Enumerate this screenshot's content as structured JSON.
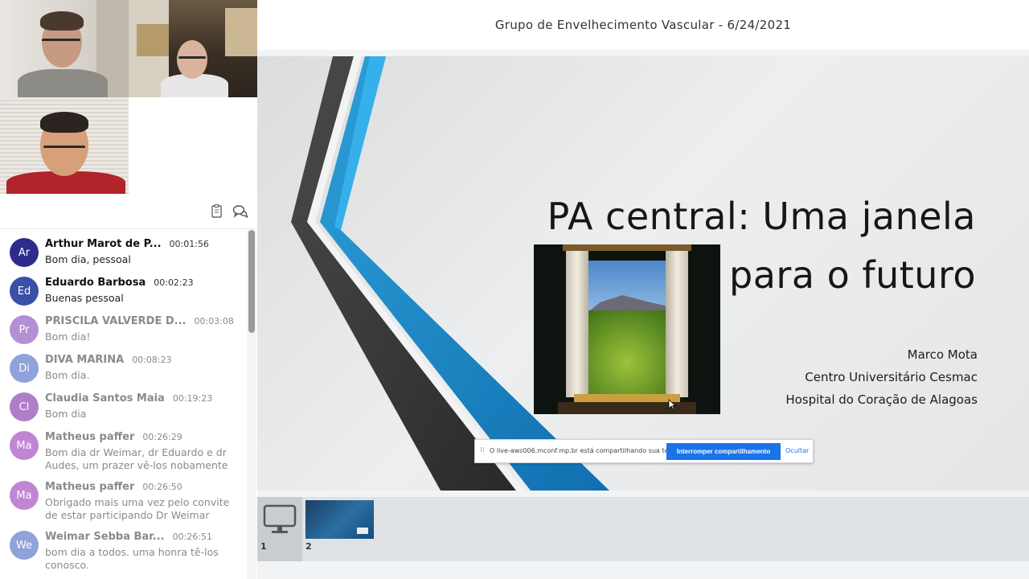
{
  "meeting": {
    "title": "Grupo de Envelhecimento Vascular - 6/24/2021"
  },
  "chat": {
    "toolbar_icons": [
      "copy-icon",
      "chat-bubbles-icon"
    ],
    "messages": [
      {
        "initials": "Ar",
        "name": "Arthur Marot de P...",
        "time": "00:01:56",
        "text": "Bom dia, pessoal",
        "color": "#2c2c8c",
        "faded": false
      },
      {
        "initials": "Ed",
        "name": "Eduardo Barbosa",
        "time": "00:02:23",
        "text": "Buenas pessoal",
        "color": "#3a4fa8",
        "faded": false
      },
      {
        "initials": "Pr",
        "name": "PRISCILA VALVERDE D...",
        "time": "00:03:08",
        "text": "Bom dia!",
        "color": "#b58fd6",
        "faded": true
      },
      {
        "initials": "Di",
        "name": "DIVA MARINA",
        "time": "00:08:23",
        "text": "Bom dia.",
        "color": "#8fa2d9",
        "faded": true
      },
      {
        "initials": "Cl",
        "name": "Claudia Santos Maia",
        "time": "00:19:23",
        "text": "Bom dia",
        "color": "#b07ec9",
        "faded": true
      },
      {
        "initials": "Ma",
        "name": "Matheus paffer",
        "time": "00:26:29",
        "text": "Bom dia dr Weimar, dr Eduardo e dr Audes, um prazer vê-los nobamente",
        "color": "#c086d4",
        "faded": true
      },
      {
        "initials": "Ma",
        "name": "Matheus paffer",
        "time": "00:26:50",
        "text": "Obrigado mais uma vez pelo convite de estar participando Dr Weimar",
        "color": "#c086d4",
        "faded": true
      },
      {
        "initials": "We",
        "name": "Weimar Sebba Bar...",
        "time": "00:26:51",
        "text": "bom dia a todos. uma honra tê-los conosco.",
        "color": "#8fa2d9",
        "faded": true
      }
    ]
  },
  "slide": {
    "title_line1": "PA central: Uma janela",
    "title_line2": "para o futuro",
    "author": "Marco Mota",
    "affiliation1": "Centro Universitário Cesmac",
    "affiliation2": "Hospital do Coração de Alagoas"
  },
  "share_bar": {
    "message": "O live-aws006.mconf.mp.br está compartilhando sua tela.",
    "stop_label": "Interromper compartilhamento",
    "hide_label": "Ocultar"
  },
  "thumbnails": [
    {
      "number": "1",
      "kind": "screen-share",
      "icon": "monitor-icon"
    },
    {
      "number": "2",
      "kind": "slide"
    }
  ]
}
